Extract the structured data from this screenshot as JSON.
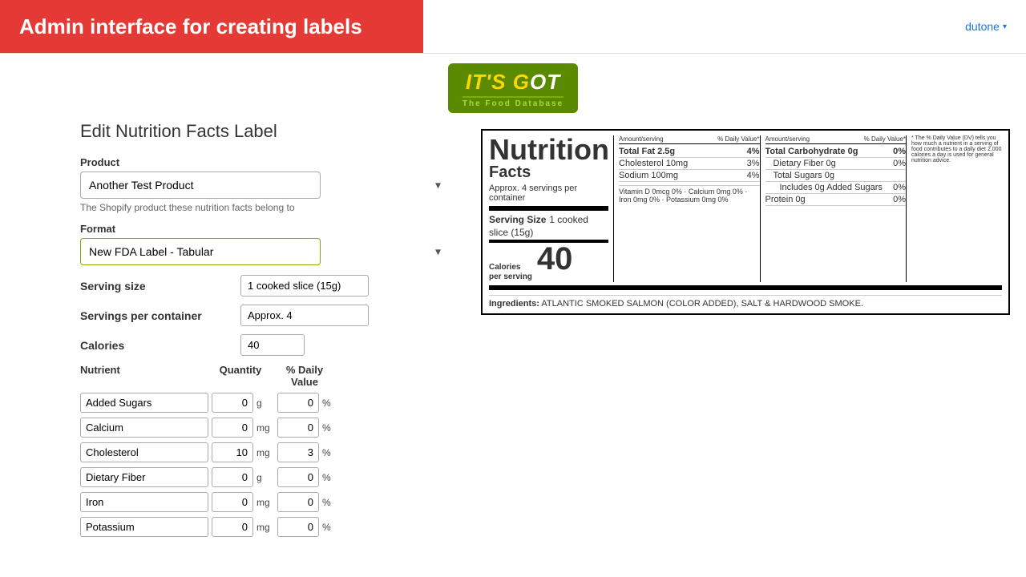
{
  "header": {
    "title": "Admin interface for creating labels",
    "user": "dutone",
    "user_dropdown": "▾"
  },
  "logo": {
    "its": "It's",
    "got": "Got",
    "subtitle": "The Food Database"
  },
  "form": {
    "page_title": "Edit Nutrition Facts Label",
    "product_label": "Product",
    "product_value": "Another Test Product",
    "product_hint": "The Shopify product these nutrition facts belong to",
    "format_label": "Format",
    "format_value": "New FDA Label - Tabular",
    "serving_size_label": "Serving size",
    "serving_size_value": "1 cooked slice (15g)",
    "servings_per_container_label": "Servings per container",
    "servings_per_container_value": "Approx. 4",
    "calories_label": "Calories",
    "calories_value": "40",
    "nutrients_header_nutrient": "Nutrient",
    "nutrients_header_qty": "Quantity",
    "nutrients_header_pct": "% Daily Value",
    "nutrients": [
      {
        "name": "Added Sugars",
        "qty": "0",
        "unit": "g",
        "pct": "0"
      },
      {
        "name": "Calcium",
        "qty": "0",
        "unit": "mg",
        "pct": "0"
      },
      {
        "name": "Cholesterol",
        "qty": "10",
        "unit": "mg",
        "pct": "3"
      },
      {
        "name": "Dietary Fiber",
        "qty": "0",
        "unit": "g",
        "pct": "0"
      },
      {
        "name": "Iron",
        "qty": "0",
        "unit": "mg",
        "pct": "0"
      },
      {
        "name": "Potassium",
        "qty": "0",
        "unit": "mg",
        "pct": "0"
      }
    ]
  },
  "nutrition_label": {
    "title": "Nutrition",
    "facts": "Facts",
    "servings_approx": "Approx. 4 servings per",
    "servings_container": "container",
    "serving_size_label": "Serving Size",
    "serving_size_val": "1 cooked slice (15g)",
    "calories_label": "Calories",
    "calories_per": "per serving",
    "calories_num": "40",
    "col1_header": "Amount/serving",
    "col1_pct_header": "% Daily Value*",
    "col2_header": "Amount/serving",
    "col2_pct_header": "% Daily Value*",
    "col1_rows": [
      {
        "label": "Total Fat 2.5g",
        "pct": "4%",
        "bold": true
      },
      {
        "label": "Cholesterol 10mg",
        "pct": "3%",
        "bold": false
      },
      {
        "label": "Sodium 100mg",
        "pct": "4%",
        "bold": false
      }
    ],
    "col2_rows": [
      {
        "label": "Total Carbohydrate 0g",
        "pct": "0%",
        "bold": true
      },
      {
        "label": "Dietary Fiber 0g",
        "pct": "0%",
        "bold": false,
        "indent": true
      },
      {
        "label": "Total Sugars 0g",
        "pct": "",
        "bold": false,
        "indent": true
      },
      {
        "label": "Includes 0g Added Sugars",
        "pct": "0%",
        "bold": false,
        "extra_indent": true
      },
      {
        "label": "Protein 0g",
        "pct": "0%",
        "bold": false
      }
    ],
    "vitamin_row": "Vitamin D 0mcg 0%  ·  Calcium 0mg 0%  ·  Iron 0mg 0%  ·  Potassium 0mg 0%",
    "dv_note": "* The % Daily Value (DV) tells you how much a nutrient in a serving of food contributes to a daily diet 2,000 calories a day is used for general nutrition advice.",
    "ingredients_label": "Ingredients:",
    "ingredients_text": "ATLANTIC SMOKED SALMON (COLOR ADDED), SALT & HARDWOOD SMOKE."
  }
}
